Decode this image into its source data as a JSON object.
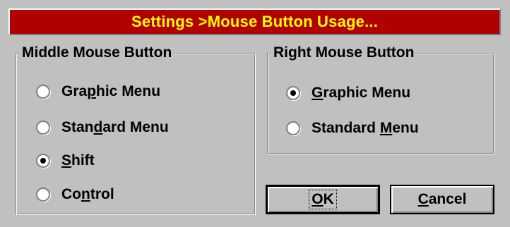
{
  "dialog": {
    "title": "Settings >Mouse Button Usage..."
  },
  "middle_group": {
    "legend": "Middle Mouse Button",
    "options": [
      {
        "pre": "Gra",
        "accel": "p",
        "post": "hic Menu",
        "checked": false
      },
      {
        "pre": "Stan",
        "accel": "d",
        "post": "ard Menu",
        "checked": false
      },
      {
        "pre": "",
        "accel": "S",
        "post": "hift",
        "checked": true
      },
      {
        "pre": "Co",
        "accel": "n",
        "post": "trol",
        "checked": false
      }
    ]
  },
  "right_group": {
    "legend": "Right Mouse Button",
    "options": [
      {
        "pre": "",
        "accel": "G",
        "post": "raphic Menu",
        "checked": true
      },
      {
        "pre": "Standard ",
        "accel": "M",
        "post": "enu",
        "checked": false
      }
    ]
  },
  "buttons": {
    "ok": {
      "pre": "",
      "accel": "O",
      "post": "K"
    },
    "cancel": {
      "pre": "",
      "accel": "C",
      "post": "ancel"
    }
  },
  "colors": {
    "title_bg": "#b00000",
    "title_text": "#ffff00",
    "face": "#c0c0c0"
  }
}
